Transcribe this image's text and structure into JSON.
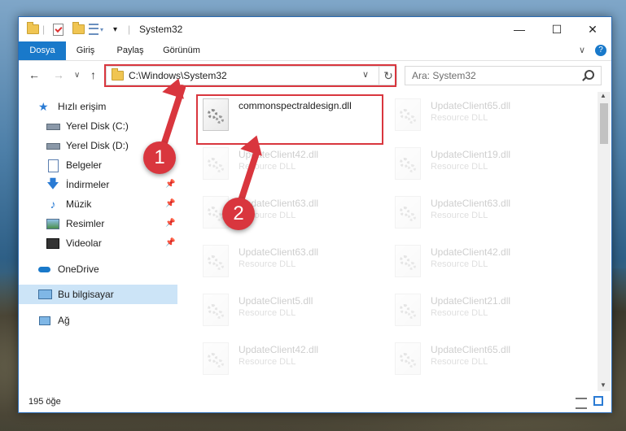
{
  "window": {
    "title": "System32",
    "minimize": "—",
    "maximize": "☐",
    "close": "✕"
  },
  "ribbon": {
    "tabs": [
      {
        "label": "Dosya"
      },
      {
        "label": "Giriş"
      },
      {
        "label": "Paylaş"
      },
      {
        "label": "Görünüm"
      }
    ],
    "expand": "∨",
    "help": "?"
  },
  "nav": {
    "back": "←",
    "forward": "→",
    "recent": "∨",
    "up": "↑",
    "address": "C:\\Windows\\System32",
    "address_dropdown": "∨",
    "refresh": "↻",
    "search_placeholder": "Ara: System32"
  },
  "sidebar": {
    "items": [
      {
        "label": "Hızlı erişim",
        "icon": "star-icon"
      },
      {
        "label": "Yerel Disk (C:)",
        "icon": "drive-icon"
      },
      {
        "label": "Yerel Disk (D:)",
        "icon": "drive-icon"
      },
      {
        "label": "Belgeler",
        "icon": "documents-icon"
      },
      {
        "label": "İndirmeler",
        "icon": "download-icon"
      },
      {
        "label": "Müzik",
        "icon": "music-icon"
      },
      {
        "label": "Resimler",
        "icon": "pictures-icon"
      },
      {
        "label": "Videolar",
        "icon": "videos-icon"
      },
      {
        "label": "OneDrive",
        "icon": "cloud-icon"
      },
      {
        "label": "Bu bilgisayar",
        "icon": "computer-icon"
      },
      {
        "label": "Ağ",
        "icon": "network-icon"
      }
    ]
  },
  "files": {
    "highlighted": {
      "name": "commonspectraldesign.dll"
    },
    "faded": [
      {
        "name": "UpdateClient65.dll",
        "type": "Resource DLL"
      },
      {
        "name": "UpdateClient42.dll",
        "type": "Resource DLL"
      },
      {
        "name": "UpdateClient19.dll",
        "type": "Resource DLL"
      },
      {
        "name": "UpdateClient63.dll",
        "type": "Resource DLL"
      },
      {
        "name": "UpdateClient63.dll",
        "type": "Resource DLL"
      },
      {
        "name": "UpdateClient63.dll",
        "type": "Resource DLL"
      },
      {
        "name": "UpdateClient42.dll",
        "type": "Resource DLL"
      },
      {
        "name": "UpdateClient5.dll",
        "type": "Resource DLL"
      },
      {
        "name": "UpdateClient21.dll",
        "type": "Resource DLL"
      },
      {
        "name": "UpdateClient42.dll",
        "type": "Resource DLL"
      },
      {
        "name": "UpdateClient65.dll",
        "type": "Resource DLL"
      }
    ]
  },
  "status": {
    "count": "195 öğe"
  },
  "annotations": {
    "step1": "1",
    "step2": "2",
    "color": "#d9363e"
  }
}
